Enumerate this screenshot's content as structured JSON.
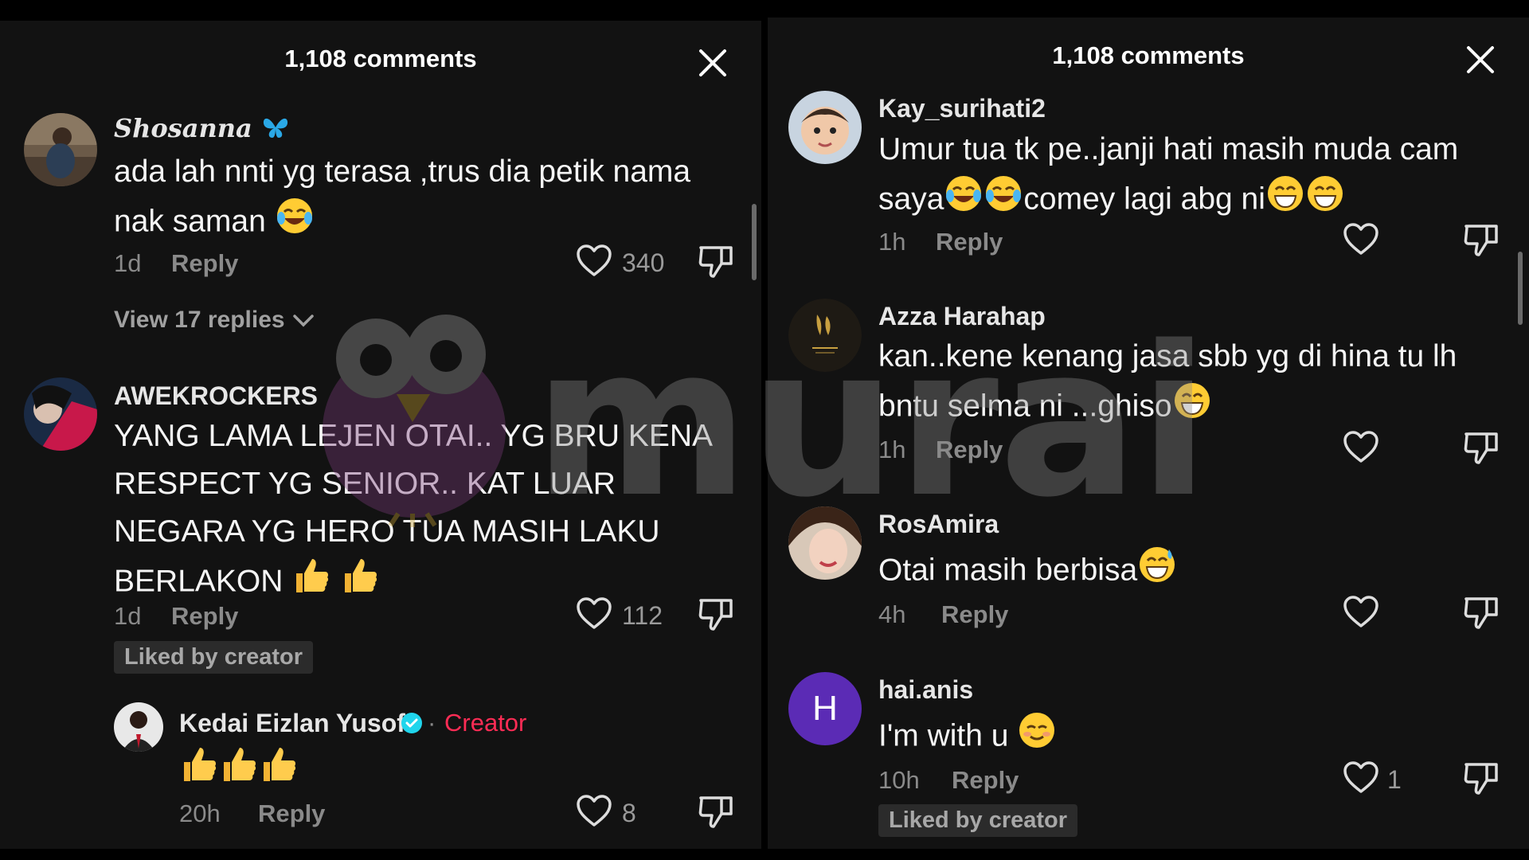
{
  "left": {
    "header_title": "1,108 comments",
    "comments": [
      {
        "username": "Shosanna",
        "text": "ada lah nnti yg terasa ,trus dia petik nama nak saman",
        "time": "1d",
        "reply_label": "Reply",
        "likes": "340",
        "view_replies": "View 17 replies"
      },
      {
        "username": "AWEKROCKERS",
        "text": "YANG LAMA LEJEN OTAI.. YG BRU KENA RESPECT YG SENIOR.. KAT LUAR NEGARA YG HERO TUA MASIH LAKU BERLAKON",
        "time": "1d",
        "reply_label": "Reply",
        "likes": "112",
        "liked_badge": "Liked by creator"
      },
      {
        "username": "Kedai Eizlan Yusof",
        "creator_tag": "Creator",
        "time": "20h",
        "reply_label": "Reply",
        "likes": "8"
      }
    ]
  },
  "right": {
    "header_title": "1,108 comments",
    "comments": [
      {
        "username": "Kay_surihati2",
        "text": "Umur tua tk pe..janji hati masih muda cam saya",
        "text_tail": "comey lagi abg ni",
        "time": "1h",
        "reply_label": "Reply"
      },
      {
        "username": "Azza Harahap",
        "text": "kan..kene kenang jasa sbb yg di hina tu lh bntu selma ni ...ghiso",
        "time": "1h",
        "reply_label": "Reply"
      },
      {
        "username": "RosAmira",
        "text": "Otai masih berbisa",
        "time": "4h",
        "reply_label": "Reply"
      },
      {
        "username": "hai.anis",
        "avatar_letter": "H",
        "text": "I'm with u",
        "time": "10h",
        "reply_label": "Reply",
        "likes": "1",
        "liked_badge": "Liked by creator"
      }
    ]
  },
  "watermark_text": "murai",
  "colors": {
    "background": "#121212",
    "creator_tag": "#fe2c55",
    "verified": "#20d5ec",
    "avatar_h": "#5b2bb5",
    "badge_bg": "#2b2b2b"
  }
}
